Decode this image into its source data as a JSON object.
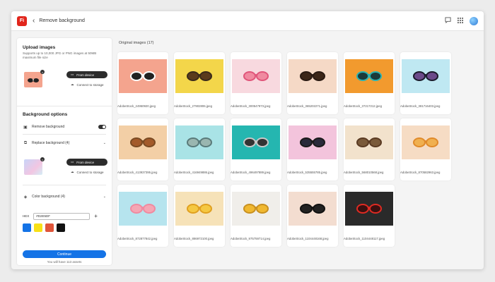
{
  "app": {
    "logo_text": "Fi",
    "page_title": "Remove background"
  },
  "topbar_icons": [
    "chat-icon",
    "apps-grid-icon",
    "avatar"
  ],
  "sidebar": {
    "upload": {
      "title": "Upload images",
      "description": "Supports up to 10,000 JPG or PNG images at 50MB maximum file size",
      "from_device": "From device",
      "connect_storage": "Connect to storage"
    },
    "background_options": {
      "title": "Background options",
      "remove_background": "Remove background",
      "replace_background": "Replace background (4)",
      "from_device": "From device",
      "connect_storage": "Connect to storage",
      "color_background": "Color background (4)",
      "hex_label": "HEX",
      "hex_value": "#D2E5DF",
      "swatches": [
        "#1473e6",
        "#f7e018",
        "#e0553a",
        "#111111"
      ]
    },
    "continue_label": "Continue",
    "assets_note": "You will have 113 assets"
  },
  "main": {
    "section_label": "Original images (17)",
    "images": [
      {
        "file": "AdobeStock_24950920.jpeg",
        "bg": "#f4a48e",
        "frame": "#ffffff",
        "lens": "#222222"
      },
      {
        "file": "AdobeStock_27902806.jpeg",
        "bg": "#f3d64a",
        "frame": "#3a2a1a",
        "lens": "#5a3b1c"
      },
      {
        "file": "AdobeStock_300547973.jpeg",
        "bg": "#f8d9df",
        "frame": "#e0557a",
        "lens": "#f08aa0"
      },
      {
        "file": "AdobeStock_365202271.jpeg",
        "bg": "#f5d9c6",
        "frame": "#2a1a12",
        "lens": "#3c2618"
      },
      {
        "file": "AdobeStock_37217212.jpeg",
        "bg": "#f29a2e",
        "frame": "#2ab3b3",
        "lens": "#1a3a3a"
      },
      {
        "file": "AdobeStock_381716403.jpeg",
        "bg": "#bfe8f2",
        "frame": "#1a1a2a",
        "lens": "#6b4a8a"
      },
      {
        "file": "AdobeStock_413937395.jpeg",
        "bg": "#f3cfa6",
        "frame": "#7a4a22",
        "lens": "#a35a2a"
      },
      {
        "file": "AdobeStock_416949886.jpeg",
        "bg": "#a9e3e6",
        "frame": "#5a7a7a",
        "lens": "#9ab6b0"
      },
      {
        "file": "AdobeStock_496497889.jpeg",
        "bg": "#25b6b0",
        "frame": "#c8c8c8",
        "lens": "#333333"
      },
      {
        "file": "AdobeStock_535555785.jpeg",
        "bg": "#f3c4dc",
        "frame": "#1a1a1a",
        "lens": "#2a2a3a"
      },
      {
        "file": "AdobeStock_568010568.jpeg",
        "bg": "#f2e2cc",
        "frame": "#5a3a22",
        "lens": "#7a5a3a"
      },
      {
        "file": "AdobeStock_870582963.jpeg",
        "bg": "#f6dcc4",
        "frame": "#e08a2a",
        "lens": "#f0b050"
      },
      {
        "file": "AdobeStock_872877842.jpeg",
        "bg": "#b6e4ee",
        "frame": "#f08aa0",
        "lens": "#f5a6b4"
      },
      {
        "file": "AdobeStock_886972100.jpeg",
        "bg": "#f6e2b8",
        "frame": "#e0a020",
        "lens": "#f5c842"
      },
      {
        "file": "AdobeStock_975759714.jpeg",
        "bg": "#f0eeea",
        "frame": "#c89020",
        "lens": "#f0b830"
      },
      {
        "file": "AdobeStock_1104448168.jpeg",
        "bg": "#f3ddd0",
        "frame": "#111111",
        "lens": "#222222"
      },
      {
        "file": "AdobeStock_1104448117.jpeg",
        "bg": "#2a2a2a",
        "frame": "#e02a22",
        "lens": "#3a1010"
      }
    ]
  }
}
